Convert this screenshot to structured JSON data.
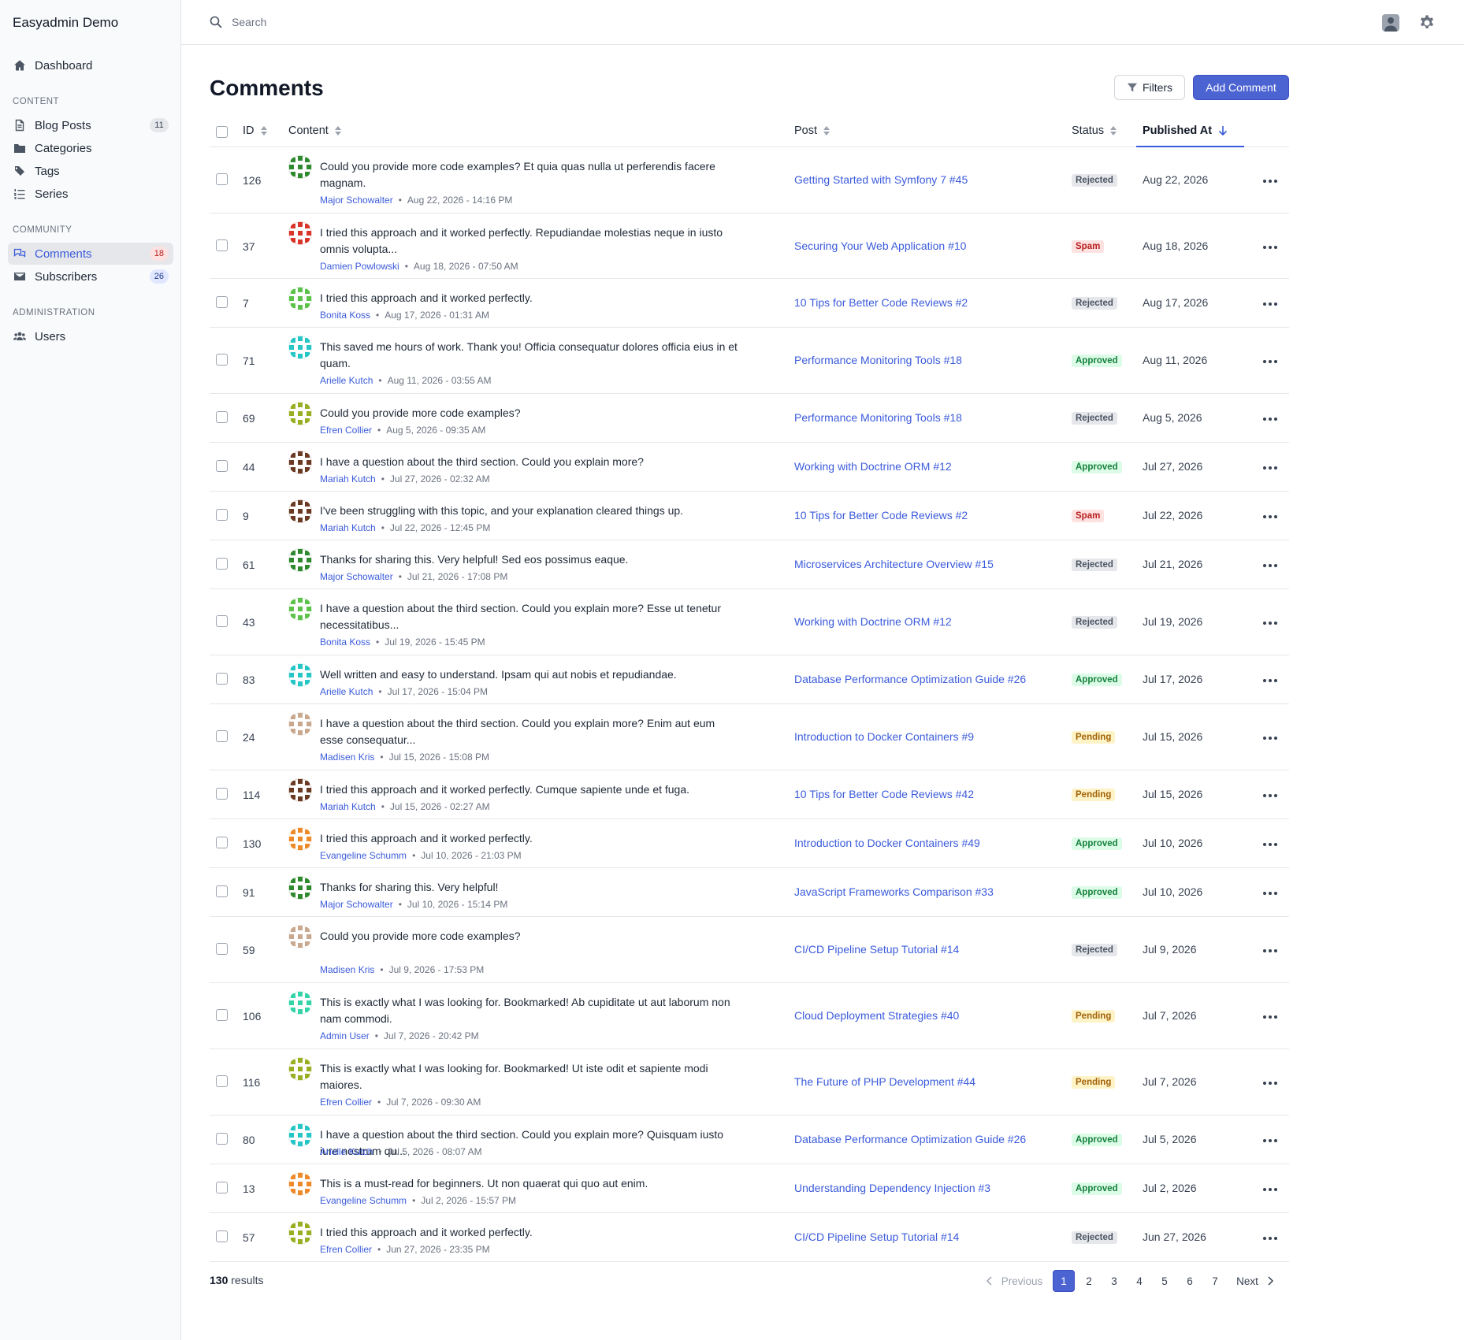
{
  "app": {
    "title": "Easyadmin Demo"
  },
  "sidebar": {
    "dashboard": "Dashboard",
    "sections": [
      {
        "label": "CONTENT",
        "items": [
          {
            "label": "Blog Posts",
            "badge": "11"
          },
          {
            "label": "Categories"
          },
          {
            "label": "Tags"
          },
          {
            "label": "Series"
          }
        ]
      },
      {
        "label": "COMMUNITY",
        "items": [
          {
            "label": "Comments",
            "badge": "18"
          },
          {
            "label": "Subscribers",
            "badge": "26"
          }
        ]
      },
      {
        "label": "ADMINISTRATION",
        "items": [
          {
            "label": "Users"
          }
        ]
      }
    ]
  },
  "topbar": {
    "search_placeholder": "Search"
  },
  "page": {
    "title": "Comments",
    "filters_label": "Filters",
    "add_label": "Add Comment"
  },
  "table": {
    "columns": {
      "id": "ID",
      "content": "Content",
      "post": "Post",
      "status": "Status",
      "published": "Published At"
    },
    "rows": [
      {
        "id": "126",
        "content": "Could you provide more code examples? Et quia quas nulla ut perferendis facere magnam.",
        "author": "Major Schowalter",
        "when": "Aug 22, 2026 - 14:16 PM",
        "post": "Getting Started with Symfony 7 #45",
        "status": "Rejected",
        "date": "Aug 22, 2026",
        "avatar": "green-dark"
      },
      {
        "id": "37",
        "content": "I tried this approach and it worked perfectly. Repudiandae molestias neque in iusto omnis volupta...",
        "author": "Damien Powlowski",
        "when": "Aug 18, 2026 - 07:50 AM",
        "post": "Securing Your Web Application #10",
        "status": "Spam",
        "date": "Aug 18, 2026",
        "avatar": "red"
      },
      {
        "id": "7",
        "content": "I tried this approach and it worked perfectly.",
        "author": "Bonita Koss",
        "when": "Aug 17, 2026 - 01:31 AM",
        "post": "10 Tips for Better Code Reviews #2",
        "status": "Rejected",
        "date": "Aug 17, 2026",
        "avatar": "green-light"
      },
      {
        "id": "71",
        "content": "This saved me hours of work. Thank you! Officia consequatur dolores officia eius in et quam.",
        "author": "Arielle Kutch",
        "when": "Aug 11, 2026 - 03:55 AM",
        "post": "Performance Monitoring Tools #18",
        "status": "Approved",
        "date": "Aug 11, 2026",
        "avatar": "teal"
      },
      {
        "id": "69",
        "content": "Could you provide more code examples?",
        "author": "Efren Collier",
        "when": "Aug 5, 2026 - 09:35 AM",
        "post": "Performance Monitoring Tools #18",
        "status": "Rejected",
        "date": "Aug 5, 2026",
        "avatar": "olive"
      },
      {
        "id": "44",
        "content": "I have a question about the third section. Could you explain more?",
        "author": "Mariah Kutch",
        "when": "Jul 27, 2026 - 02:32 AM",
        "post": "Working with Doctrine ORM #12",
        "status": "Approved",
        "date": "Jul 27, 2026",
        "avatar": "brown"
      },
      {
        "id": "9",
        "content": "I've been struggling with this topic, and your explanation cleared things up.",
        "author": "Mariah Kutch",
        "when": "Jul 22, 2026 - 12:45 PM",
        "post": "10 Tips for Better Code Reviews #2",
        "status": "Spam",
        "date": "Jul 22, 2026",
        "avatar": "brown"
      },
      {
        "id": "61",
        "content": "Thanks for sharing this. Very helpful! Sed eos possimus eaque.",
        "author": "Major Schowalter",
        "when": "Jul 21, 2026 - 17:08 PM",
        "post": "Microservices Architecture Overview #15",
        "status": "Rejected",
        "date": "Jul 21, 2026",
        "avatar": "green-dark"
      },
      {
        "id": "43",
        "content": "I have a question about the third section. Could you explain more? Esse ut tenetur necessitatibus...",
        "author": "Bonita Koss",
        "when": "Jul 19, 2026 - 15:45 PM",
        "post": "Working with Doctrine ORM #12",
        "status": "Rejected",
        "date": "Jul 19, 2026",
        "avatar": "green-light"
      },
      {
        "id": "83",
        "content": "Well written and easy to understand. Ipsam qui aut nobis et repudiandae.",
        "author": "Arielle Kutch",
        "when": "Jul 17, 2026 - 15:04 PM",
        "post": "Database Performance Optimization Guide #26",
        "status": "Approved",
        "date": "Jul 17, 2026",
        "avatar": "teal"
      },
      {
        "id": "24",
        "content": "I have a question about the third section. Could you explain more? Enim aut eum esse consequatur...",
        "author": "Madisen Kris",
        "when": "Jul 15, 2026 - 15:08 PM",
        "post": "Introduction to Docker Containers #9",
        "status": "Pending",
        "date": "Jul 15, 2026",
        "avatar": "tan"
      },
      {
        "id": "114",
        "content": "I tried this approach and it worked perfectly. Cumque sapiente unde et fuga.",
        "author": "Mariah Kutch",
        "when": "Jul 15, 2026 - 02:27 AM",
        "post": "10 Tips for Better Code Reviews #42",
        "status": "Pending",
        "date": "Jul 15, 2026",
        "avatar": "brown"
      },
      {
        "id": "130",
        "content": "I tried this approach and it worked perfectly.",
        "author": "Evangeline Schumm",
        "when": "Jul 10, 2026 - 21:03 PM",
        "post": "Introduction to Docker Containers #49",
        "status": "Approved",
        "date": "Jul 10, 2026",
        "avatar": "orange"
      },
      {
        "id": "91",
        "content": "Thanks for sharing this. Very helpful!",
        "author": "Major Schowalter",
        "when": "Jul 10, 2026 - 15:14 PM",
        "post": "JavaScript Frameworks Comparison #33",
        "status": "Approved",
        "date": "Jul 10, 2026",
        "avatar": "green-dark"
      },
      {
        "id": "59",
        "content": "Could you provide more code examples?",
        "author": "Madisen Kris",
        "when": "Jul 9, 2026 - 17:53 PM",
        "post": "CI/CD Pipeline Setup Tutorial #14",
        "status": "Rejected",
        "date": "Jul 9, 2026",
        "avatar": "tan"
      },
      {
        "id": "106",
        "content": "This is exactly what I was looking for. Bookmarked! Ab cupiditate ut aut laborum non nam commodi.",
        "author": "Admin User",
        "when": "Jul 7, 2026 - 20:42 PM",
        "post": "Cloud Deployment Strategies #40",
        "status": "Pending",
        "date": "Jul 7, 2026",
        "avatar": "mint"
      },
      {
        "id": "116",
        "content": "This is exactly what I was looking for. Bookmarked! Ut iste odit et sapiente modi maiores.",
        "author": "Efren Collier",
        "when": "Jul 7, 2026 - 09:30 AM",
        "post": "The Future of PHP Development #44",
        "status": "Pending",
        "date": "Jul 7, 2026",
        "avatar": "olive"
      },
      {
        "id": "80",
        "content": "I have a question about the third section. Could you explain more? Quisquam iusto iure nostrum qu...",
        "author": "Arielle Kutch",
        "when": "Jul 5, 2026 - 08:07 AM",
        "post": "Database Performance Optimization Guide #26",
        "status": "Approved",
        "date": "Jul 5, 2026",
        "avatar": "teal"
      },
      {
        "id": "13",
        "content": "This is a must-read for beginners. Ut non quaerat qui quo aut enim.",
        "author": "Evangeline Schumm",
        "when": "Jul 2, 2026 - 15:57 PM",
        "post": "Understanding Dependency Injection #3",
        "status": "Approved",
        "date": "Jul 2, 2026",
        "avatar": "orange"
      },
      {
        "id": "57",
        "content": "I tried this approach and it worked perfectly.",
        "author": "Efren Collier",
        "when": "Jun 27, 2026 - 23:35 PM",
        "post": "CI/CD Pipeline Setup Tutorial #14",
        "status": "Rejected",
        "date": "Jun 27, 2026",
        "avatar": "olive"
      }
    ]
  },
  "footer": {
    "results_count": "130",
    "results_label": "results",
    "previous": "Previous",
    "next": "Next",
    "pages": [
      "1",
      "2",
      "3",
      "4",
      "5",
      "6",
      "7"
    ],
    "current_page": "1"
  },
  "colors": {
    "accent": "#3b5bdb",
    "primary_button": "#4c63d2",
    "avatar": {
      "green-dark": "#2f8a2f",
      "red": "#d9352a",
      "green-light": "#5cc24a",
      "teal": "#26c6c6",
      "olive": "#9aae22",
      "brown": "#6b3a22",
      "tan": "#c8a88e",
      "orange": "#ef8a2a",
      "mint": "#35d3a8"
    }
  }
}
